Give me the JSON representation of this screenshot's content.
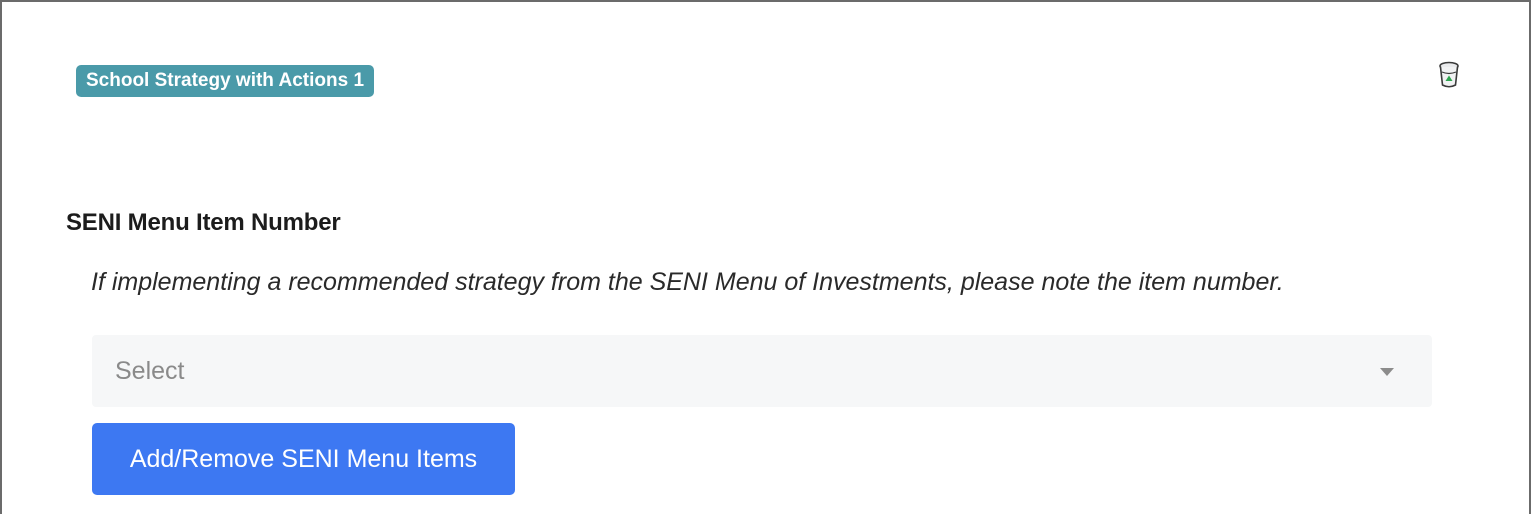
{
  "header": {
    "badge_label": "School Strategy with Actions 1",
    "delete_icon": "trash-icon"
  },
  "field": {
    "title": "SENI Menu Item Number",
    "hint": "If implementing a recommended strategy from the SENI Menu of Investments, please note the item number.",
    "select_placeholder": "Select",
    "select_caret_icon": "chevron-down-icon"
  },
  "actions": {
    "add_remove_label": "Add/Remove SENI Menu Items"
  },
  "colors": {
    "badge": "#4a9aa9",
    "primary_button": "#3d78f2",
    "select_background": "#f6f7f8"
  }
}
